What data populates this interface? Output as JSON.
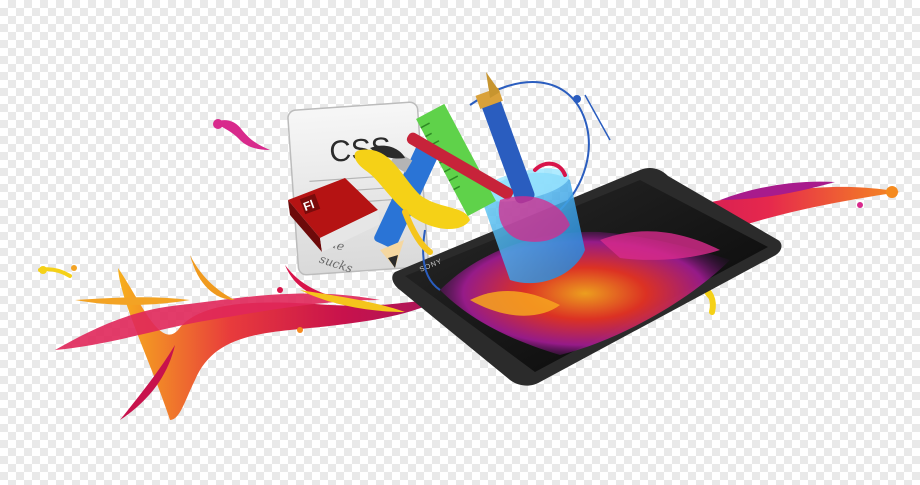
{
  "image": {
    "css_sheet_text": "CSS",
    "flash_book_text": "Fl",
    "handwritten_text_1": "ie",
    "handwritten_text_2": "sucks",
    "tablet_brand": "SONY"
  },
  "colors": {
    "splash_red": "#d8144a",
    "splash_orange": "#f58a1f",
    "splash_yellow": "#f5d117",
    "splash_magenta": "#d82a8c",
    "pen_blue": "#2a5dbf",
    "ruler_green": "#5fd24a",
    "tablet_black": "#141414"
  }
}
